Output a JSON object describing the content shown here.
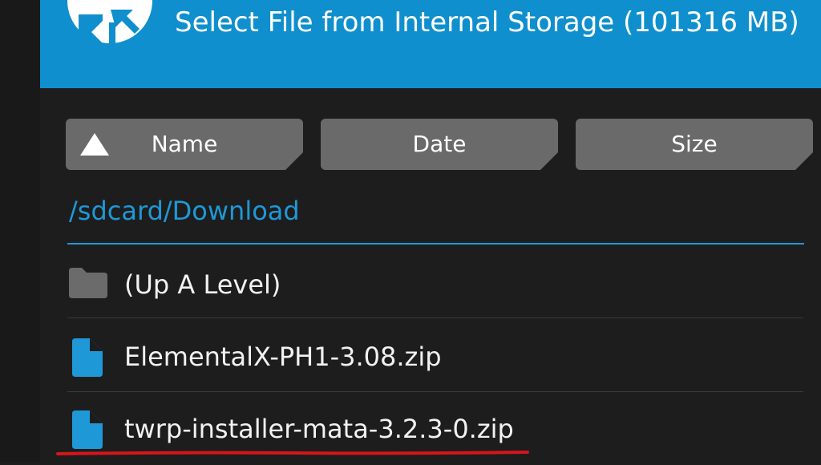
{
  "header": {
    "subtitle": "Select File from Internal Storage (101316 MB)"
  },
  "sort": {
    "name_label": "Name",
    "date_label": "Date",
    "size_label": "Size"
  },
  "path": "/sdcard/Download",
  "items": [
    {
      "label": "(Up A Level)",
      "icon": "folder-icon"
    },
    {
      "label": "ElementalX-PH1-3.08.zip",
      "icon": "file-icon"
    },
    {
      "label": "twrp-installer-mata-3.2.3-0.zip",
      "icon": "file-icon"
    }
  ],
  "colors": {
    "header_bg": "#0f8fcd",
    "background": "#1d1d1d",
    "accent": "#1f98d7",
    "button_bg": "#6a6a6a",
    "highlight": "#d8141c"
  }
}
